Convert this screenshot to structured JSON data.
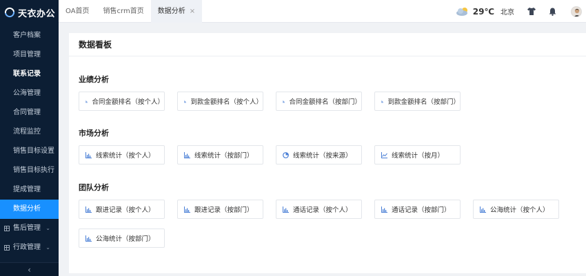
{
  "app": {
    "logo_text": "天衣办公"
  },
  "sidebar": {
    "items": [
      {
        "label": "客户档案"
      },
      {
        "label": "项目管理"
      },
      {
        "label": "联系记录"
      },
      {
        "label": "公海管理"
      },
      {
        "label": "合同管理"
      },
      {
        "label": "流程监控"
      },
      {
        "label": "销售目标设置"
      },
      {
        "label": "销售目标执行"
      },
      {
        "label": "提成管理"
      },
      {
        "label": "数据分析"
      },
      {
        "label": "售后管理"
      },
      {
        "label": "行政管理"
      }
    ],
    "collapse_glyph": "‹"
  },
  "tabs": [
    {
      "label": "OA首页"
    },
    {
      "label": "销售crm首页"
    },
    {
      "label": "数据分析",
      "close": "×"
    }
  ],
  "header": {
    "temperature": "29℃",
    "city": "北京"
  },
  "page": {
    "title": "数据看板"
  },
  "sections": [
    {
      "title": "业绩分析",
      "cards": [
        {
          "label": "合同金额排名（按个人）",
          "icon": "bar-chart-icon"
        },
        {
          "label": "到款金额排名（按个人）",
          "icon": "bar-chart-icon"
        },
        {
          "label": "合同金额排名（按部门）",
          "icon": "bar-chart-icon"
        },
        {
          "label": "到款金额排名（按部门）",
          "icon": "bar-chart-icon"
        }
      ]
    },
    {
      "title": "市场分析",
      "cards": [
        {
          "label": "线索统计（按个人）",
          "icon": "bar-chart-icon"
        },
        {
          "label": "线索统计（按部门）",
          "icon": "bar-chart-icon"
        },
        {
          "label": "线索统计（按来源）",
          "icon": "pie-chart-icon"
        },
        {
          "label": "线索统计（按月）",
          "icon": "line-chart-icon"
        }
      ]
    },
    {
      "title": "团队分析",
      "cards": [
        {
          "label": "跟进记录（按个人）",
          "icon": "bar-chart-icon"
        },
        {
          "label": "跟进记录（按部门）",
          "icon": "bar-chart-icon"
        },
        {
          "label": "通话记录（按个人）",
          "icon": "bar-chart-icon"
        },
        {
          "label": "通话记录（按部门）",
          "icon": "bar-chart-icon"
        },
        {
          "label": "公海统计（按个人）",
          "icon": "bar-chart-icon"
        },
        {
          "label": "公海统计（按部门）",
          "icon": "bar-chart-icon"
        }
      ]
    }
  ],
  "colors": {
    "sidebar_bg": "#0c1e34",
    "accent": "#1890ff"
  }
}
